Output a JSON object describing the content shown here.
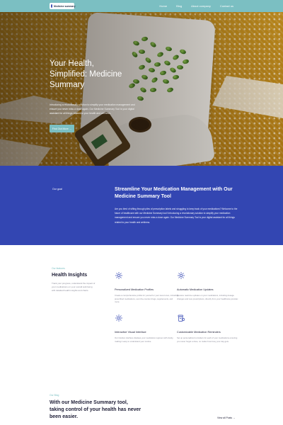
{
  "header": {
    "logo_text": "Medicine summary",
    "nav": [
      "Home",
      "Blog",
      "About company",
      "Contact us"
    ]
  },
  "hero": {
    "title_lines": [
      "Your Health,",
      "Simplified: Medicine",
      "Summary"
    ],
    "copy": "Introducing a revolutionary solution to simplify your medication management and ensure you never miss a dose again. Our Medicine Summary Tool is your digital assistant for all things related to your health and wellness.",
    "button_label": "Find Out More →"
  },
  "goal": {
    "tag": "Our goal",
    "title": "Streamline Your Medication Management with Our Medicine Summary Tool",
    "copy": "Are you tired of sifting through piles of prescription labels and struggling to keep track of your medications? Welcome to the future of healthcare with our Medicine Summary tool! Introducing a revolutionary solution to simplify your medication management and ensure you never miss a dose again. Our Medicine Summary Tool is your digital assistant for all things related to your health and wellness."
  },
  "features": {
    "tag": "Our features",
    "title": "Health Insights",
    "copy": "Track your progress, understand the impact of your medications on your overall well-being with detailed health insights and charts.",
    "items": [
      {
        "icon": "sparkle-icon",
        "title": "Personalized Medication Profiles",
        "copy": "Create a comprehensive profile for yourself or your loved ones, including prescribed medications, over-the-counter drugs, supplements, and more."
      },
      {
        "icon": "sparkle-icon",
        "title": "Automatic Medication Updates",
        "copy": "Receive real-time updates on your medications, including dosage changes and new prescriptions, directly from your healthcare provider."
      },
      {
        "icon": "sparkle-icon",
        "title": "Interactive Visual Interface",
        "copy": "Our intuitive interface displays your medication regimen with clarity, making it easy to understand your routine."
      },
      {
        "icon": "pill-bottle-icon",
        "title": "Customizable Medication Reminders",
        "copy": "Set up personalized reminders for each of your medications ensuring you never forget a dose, no matter how busy your day gets."
      }
    ]
  },
  "blog": {
    "tag": "Our Blog",
    "title": "With our Medicine Summary tool, taking control of your health has never been easier.",
    "link": "View all Posts →"
  },
  "colors": {
    "teal": "#7bbfc2",
    "royal_blue": "#3346b2"
  }
}
